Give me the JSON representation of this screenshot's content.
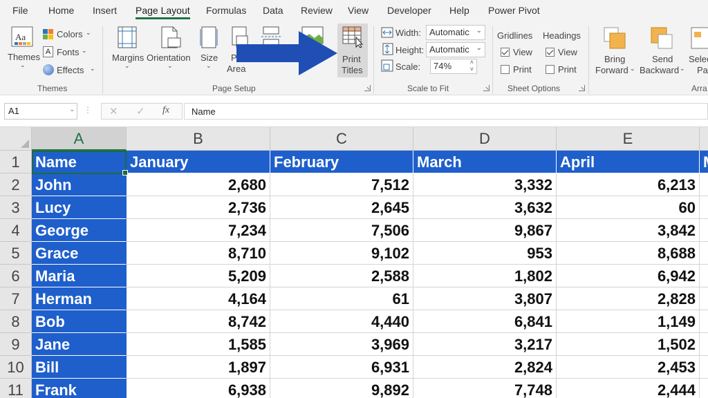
{
  "menu": {
    "tabs": [
      "File",
      "Home",
      "Insert",
      "Page Layout",
      "Formulas",
      "Data",
      "Review",
      "View",
      "Developer",
      "Help",
      "Power Pivot"
    ],
    "active": "Page Layout"
  },
  "ribbon": {
    "themes": {
      "themes_label": "Themes",
      "colors_label": "Colors",
      "fonts_label": "Fonts",
      "effects_label": "Effects",
      "group_label": "Themes"
    },
    "page_setup": {
      "margins": "Margins",
      "orientation": "Orientation",
      "size": "Size",
      "print_area_1": "Pr",
      "print_area_2": "Area",
      "print_titles_1": "Print",
      "print_titles_2": "Titles",
      "group_label": "Page Setup"
    },
    "scale_to_fit": {
      "width_label": "Width:",
      "width_value": "Automatic",
      "height_label": "Height:",
      "height_value": "Automatic",
      "scale_label": "Scale:",
      "scale_value": "74%",
      "group_label": "Scale to Fit"
    },
    "sheet_options": {
      "gridlines": "Gridlines",
      "headings": "Headings",
      "view": "View",
      "print": "Print",
      "group_label": "Sheet Options",
      "gridlines_view": true,
      "gridlines_print": false,
      "headings_view": true,
      "headings_print": false
    },
    "arrange": {
      "bring_forward_1": "Bring",
      "bring_forward_2": "Forward",
      "send_backward_1": "Send",
      "send_backward_2": "Backward",
      "selection_1": "Selec",
      "selection_2": "Pa",
      "group_label": "Arra"
    }
  },
  "formula_bar": {
    "name_box": "A1",
    "formula": "Name"
  },
  "sheet": {
    "columns": [
      "A",
      "B",
      "C",
      "D",
      "E"
    ],
    "selected_column": "A",
    "header_row": [
      "Name",
      "January",
      "February",
      "March",
      "April",
      "M"
    ],
    "rows": [
      {
        "num": "1"
      },
      {
        "num": "2",
        "name": "John",
        "values": [
          "2,680",
          "7,512",
          "3,332",
          "6,213"
        ]
      },
      {
        "num": "3",
        "name": "Lucy",
        "values": [
          "2,736",
          "2,645",
          "3,632",
          "60"
        ]
      },
      {
        "num": "4",
        "name": "George",
        "values": [
          "7,234",
          "7,506",
          "9,867",
          "3,842"
        ]
      },
      {
        "num": "5",
        "name": "Grace",
        "values": [
          "8,710",
          "9,102",
          "953",
          "8,688"
        ]
      },
      {
        "num": "6",
        "name": "Maria",
        "values": [
          "5,209",
          "2,588",
          "1,802",
          "6,942"
        ]
      },
      {
        "num": "7",
        "name": "Herman",
        "values": [
          "4,164",
          "61",
          "3,807",
          "2,828"
        ]
      },
      {
        "num": "8",
        "name": "Bob",
        "values": [
          "8,742",
          "4,440",
          "6,841",
          "1,149"
        ]
      },
      {
        "num": "9",
        "name": "Jane",
        "values": [
          "1,585",
          "3,969",
          "3,217",
          "1,502"
        ]
      },
      {
        "num": "10",
        "name": "Bill",
        "values": [
          "1,897",
          "6,931",
          "2,824",
          "2,453"
        ]
      },
      {
        "num": "11",
        "name": "Frank",
        "values": [
          "6,938",
          "9,892",
          "7,748",
          "2,444"
        ]
      }
    ]
  },
  "colors": {
    "header_fill": "#1f5fcb",
    "accent_green": "#217346",
    "arrow": "#1f4fb5"
  }
}
